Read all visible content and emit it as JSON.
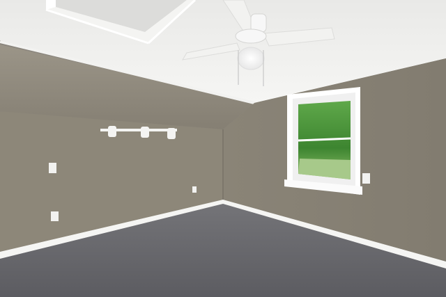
{
  "scene": {
    "kind": "photo",
    "colors": {
      "ceiling": "#efefed",
      "wall_left": "#8d8779",
      "wall_right": "#8a8478",
      "slope": "#8f897d",
      "carpet": "#6a6a6e",
      "trim": "#ffffff",
      "foliage": "#3f8a34"
    },
    "fixtures": [
      "ceiling-fan",
      "track-light",
      "window",
      "light-switch",
      "outlet",
      "skylight"
    ]
  }
}
